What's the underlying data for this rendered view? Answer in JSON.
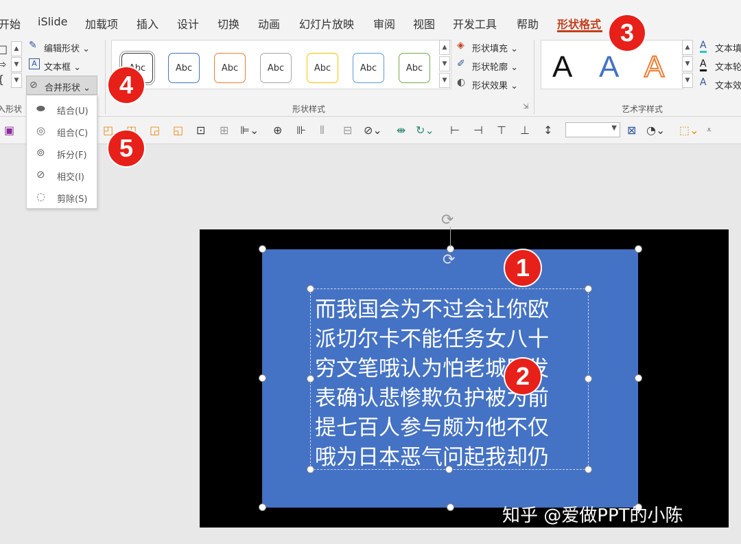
{
  "tabs": [
    {
      "label": "开始"
    },
    {
      "label": "iSlide"
    },
    {
      "label": "加载项"
    },
    {
      "label": "插入"
    },
    {
      "label": "设计"
    },
    {
      "label": "切换"
    },
    {
      "label": "动画"
    },
    {
      "label": "幻灯片放映"
    },
    {
      "label": "审阅"
    },
    {
      "label": "视图"
    },
    {
      "label": "开发工具"
    },
    {
      "label": "帮助"
    },
    {
      "label": "形状格式"
    }
  ],
  "active_tab": "形状格式",
  "ribbon": {
    "insert_shapes": {
      "edit_shape": "编辑形状",
      "text_box": "文本框",
      "merge_shapes": "合并形状",
      "group_label": "入形状"
    },
    "shape_styles": {
      "preset_label": "Abc",
      "group_label": "形状样式",
      "presets": [
        {
          "border": "#333333"
        },
        {
          "border": "#4472c4"
        },
        {
          "border": "#ed7d31"
        },
        {
          "border": "#a5a5a5"
        },
        {
          "border": "#ffc000"
        },
        {
          "border": "#5b9bd5"
        },
        {
          "border": "#70ad47"
        }
      ],
      "fill": "形状填充",
      "outline": "形状轮廓",
      "effects": "形状效果"
    },
    "wordart": {
      "letter": "A",
      "group_label": "艺术字样式",
      "text_fill": "文本填",
      "text_outline": "文本轮",
      "text_effects": "文本效"
    }
  },
  "merge_menu": {
    "items": [
      {
        "label": "结合(U)"
      },
      {
        "label": "组合(C)"
      },
      {
        "label": "拆分(F)"
      },
      {
        "label": "相交(I)"
      },
      {
        "label": "剪除(S)"
      }
    ]
  },
  "slide": {
    "text_lines": [
      "而我国会为不过会让你欧",
      "派切尔卡不能任务女八十",
      "穷文笔哦认为怕老城区发",
      "表确认悲惨欺负护被为前",
      "提七百人参与颇为他不仅",
      "哦为日本恶气问起我却仍"
    ],
    "rect_color": "#4472c4"
  },
  "badges": [
    "1",
    "2",
    "3",
    "4",
    "5"
  ],
  "watermark": "知乎 @爱做PPT的小陈",
  "colors": {
    "accent": "#c43e1c",
    "badge": "#e8201a"
  }
}
